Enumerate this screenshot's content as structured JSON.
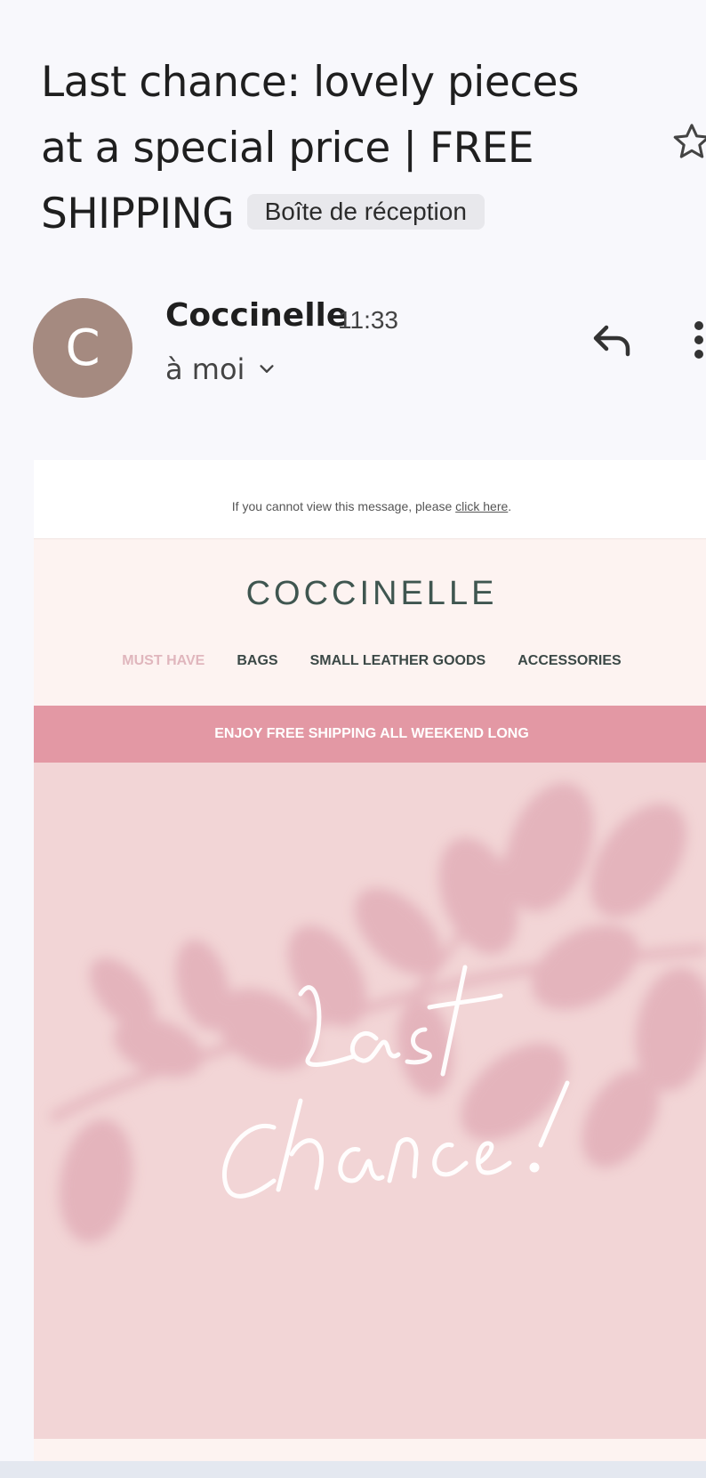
{
  "subject": {
    "text": "Last chance: lovely pieces at a special price | FREE SHIPPING",
    "label": "Boîte de réception"
  },
  "sender": {
    "avatar_letter": "C",
    "name": "Coccinelle",
    "time": "11:33",
    "recipient": "à moi"
  },
  "icons": {
    "star": "star-icon",
    "reply": "reply-icon",
    "more": "more-vert-icon",
    "expand": "chevron-down-icon"
  },
  "email": {
    "view_message_text": "If you cannot view this message, please",
    "view_message_link": "click here",
    "view_message_period": ".",
    "logo": "COCCINELLE",
    "nav": [
      "MUST HAVE",
      "BAGS",
      "SMALL LEATHER GOODS",
      "ACCESSORIES"
    ],
    "banner": "ENJOY FREE SHIPPING ALL WEEKEND LONG",
    "hero_line1": "Last",
    "hero_line2": "Chance!"
  },
  "colors": {
    "avatar": "#a58a80",
    "banner": "#e398a4",
    "hero_bg": "#f2d5d6",
    "logo": "#3f5650",
    "nav_active": "#e0b6bd"
  }
}
